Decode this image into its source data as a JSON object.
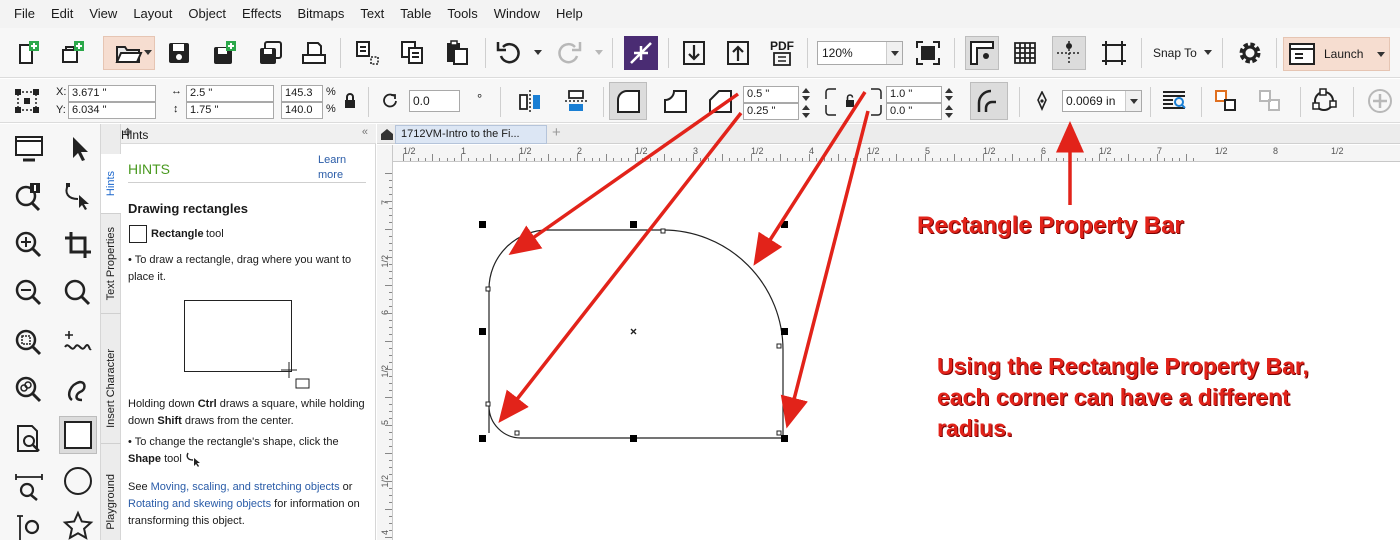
{
  "menu": [
    "File",
    "Edit",
    "View",
    "Layout",
    "Object",
    "Effects",
    "Bitmaps",
    "Text",
    "Table",
    "Tools",
    "Window",
    "Help"
  ],
  "toolbar": {
    "zoom_value": "120%",
    "snap_label": "Snap To",
    "launch_label": "Launch",
    "pdf_label": "PDF",
    "icons": [
      "new-document",
      "new-from-template",
      "open",
      "save",
      "save-as-template",
      "import",
      "export",
      "publish-pdf",
      "undo",
      "redo",
      "convert",
      "zoom-page",
      "show-rulers",
      "show-grid",
      "show-guidelines",
      "full-screen",
      "options",
      "launch"
    ]
  },
  "propbar": {
    "x_label": "X:",
    "x_value": "3.671 \"",
    "y_label": "Y:",
    "y_value": "6.034 \"",
    "width_value": "2.5 \"",
    "height_value": "1.75 \"",
    "scale_x": "145.3",
    "scale_y": "140.0",
    "percent": "%",
    "rotation_value": "0.0",
    "degree_symbol": "°",
    "corner_tl": "0.5 \"",
    "corner_bl": "0.25 \"",
    "corner_tr": "1.0 \"",
    "corner_br": "0.0 \"",
    "outline_width": "0.0069 in"
  },
  "docker": {
    "title": "Hints",
    "tabs": [
      "Hints",
      "Text Properties",
      "Insert Character",
      "Playground"
    ],
    "heading": "HINTS",
    "learn_more": "Learn more",
    "hint_title": "Drawing rectangles",
    "tool_name": "Rectangle",
    "tool_suffix": "tool",
    "step1": "• To draw a rectangle, drag where you want to place it.",
    "ctrl_pre": "Holding down ",
    "ctrl_key": "Ctrl",
    "ctrl_mid": " draws a square, while holding down ",
    "shift_key": "Shift",
    "ctrl_post": " draws from the center.",
    "step2": "• To change the rectangle's shape, click the",
    "shape_key": "Shape",
    "shape_suffix": " tool",
    "see_pre": "See ",
    "link1": "Moving, scaling, and stretching objects",
    "see_or": " or ",
    "link2": "Rotating and skewing objects",
    "see_post": " for information on transforming this object."
  },
  "document": {
    "tab_name": "1712VM-Intro to the Fi..."
  },
  "rulers": {
    "h_labels": [
      "1/2",
      "1",
      "1/2",
      "2",
      "1/2",
      "3",
      "1/2",
      "4",
      "1/2",
      "5",
      "1/2",
      "6",
      "1/2",
      "7",
      "1/2",
      "8",
      "1/2"
    ],
    "v_labels": [
      "7",
      "1/2",
      "6",
      "1/2",
      "5",
      "1/2",
      "4"
    ]
  },
  "annotations": {
    "title": "Rectangle Property Bar",
    "body": "Using the Rectangle Property Bar, each corner can have a different radius.",
    "color": "#e2231a"
  }
}
